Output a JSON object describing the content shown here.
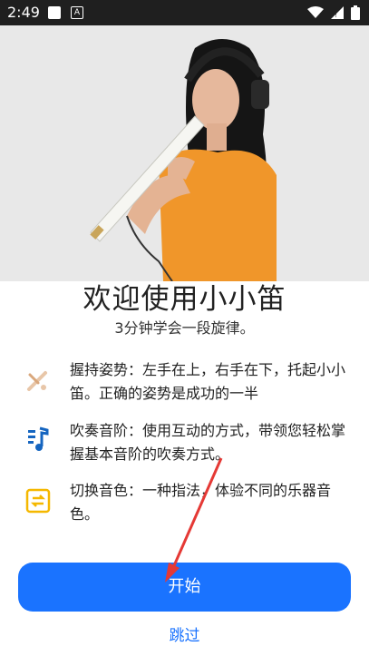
{
  "status_bar": {
    "time": "2:49",
    "notification_letter": "A"
  },
  "main": {
    "title": "欢迎使用小小笛",
    "subtitle": "3分钟学会一段旋律。",
    "features": [
      {
        "icon": "flute-icon",
        "text": "握持姿势：左手在上，右手在下，托起小小笛。正确的姿势是成功的一半"
      },
      {
        "icon": "music-note-icon",
        "text": "吹奏音阶：使用互动的方式，带领您轻松掌握基本音阶的吹奏方式。"
      },
      {
        "icon": "switch-icon",
        "text": "切换音色：一种指法，体验不同的乐器音色。"
      }
    ],
    "start_label": "开始",
    "skip_label": "跳过"
  },
  "colors": {
    "accent": "#1a73ff",
    "annotation_arrow": "#e53935",
    "feature_icon_blue": "#1565c0",
    "feature_icon_yellow": "#f5b800"
  }
}
